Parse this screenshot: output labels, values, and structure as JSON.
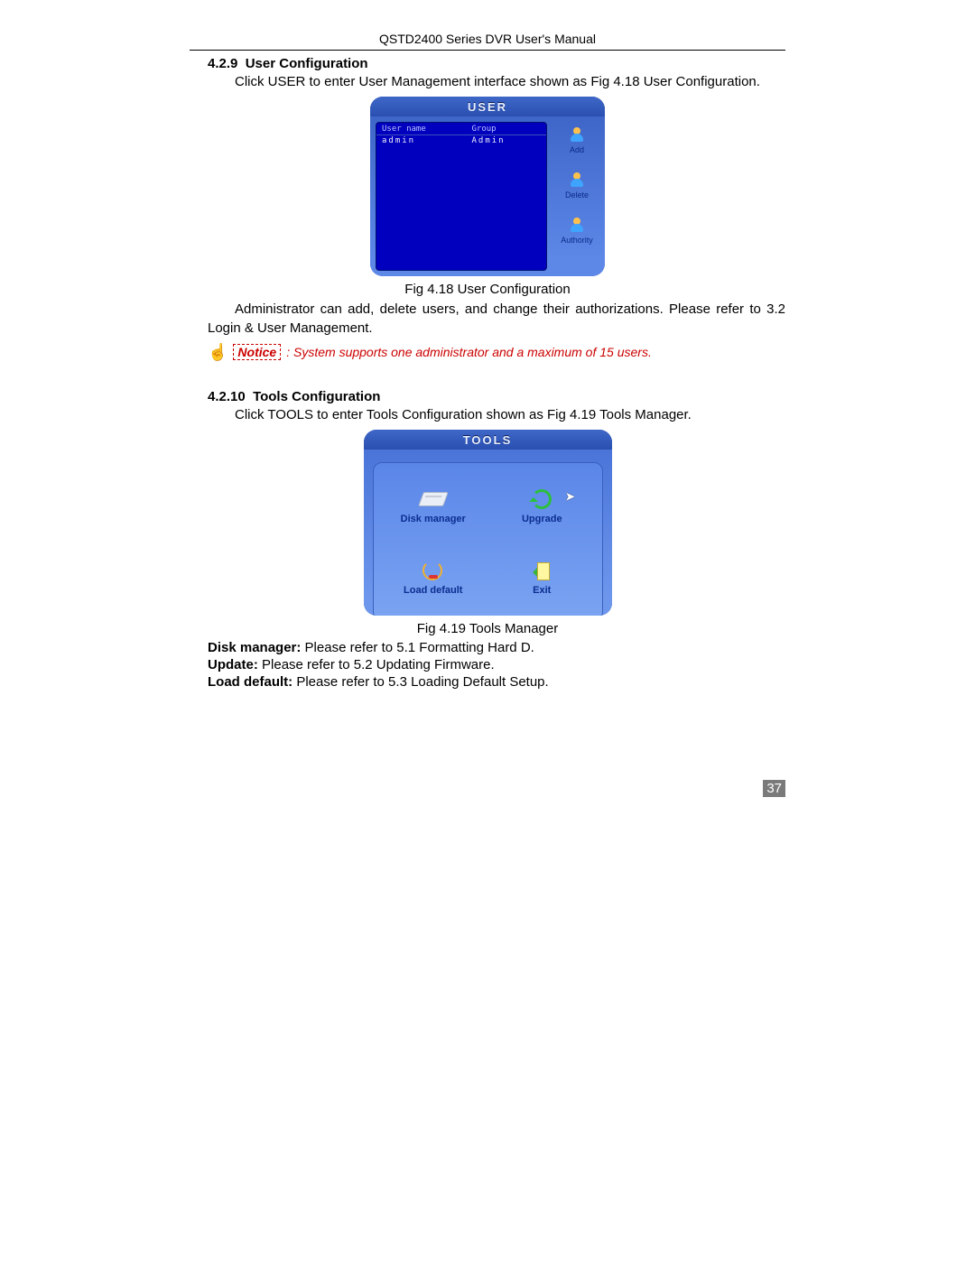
{
  "header": "QSTD2400 Series DVR User's Manual",
  "s1": {
    "num": "4.2.9",
    "title": "User Configuration",
    "p1": "Click USER to enter User Management interface shown as Fig 4.18 User Configuration.",
    "caption": "Fig 4.18 User Configuration",
    "p2": "Administrator can add, delete users, and change their authorizations. Please refer to 3.2 Login & User Management.",
    "notice_label": "Notice",
    "notice_text": ": System supports one administrator and a maximum of 15 users."
  },
  "user_window": {
    "title": "USER",
    "cols": {
      "user": "User name",
      "group": "Group"
    },
    "rows": [
      {
        "user": "admin",
        "group": "Admin"
      }
    ],
    "buttons": {
      "add": "Add",
      "delete": "Delete",
      "authority": "Authority"
    }
  },
  "s2": {
    "num": "4.2.10",
    "title": "Tools Configuration",
    "p1": "Click TOOLS to enter Tools Configuration shown as Fig 4.19 Tools Manager.",
    "caption": "Fig 4.19 Tools Manager"
  },
  "tools_window": {
    "title": "TOOLS",
    "items": {
      "disk": "Disk manager",
      "upgrade": "Upgrade",
      "default": "Load default",
      "exit": "Exit"
    }
  },
  "refs": {
    "disk_b": "Disk manager:",
    "disk_t": " Please refer to 5.1 Formatting Hard D.",
    "upd_b": "Update:",
    "upd_t": " Please refer to 5.2 Updating Firmware.",
    "def_b": "Load default:",
    "def_t": " Please refer to 5.3 Loading Default Setup."
  },
  "page_number": "37"
}
